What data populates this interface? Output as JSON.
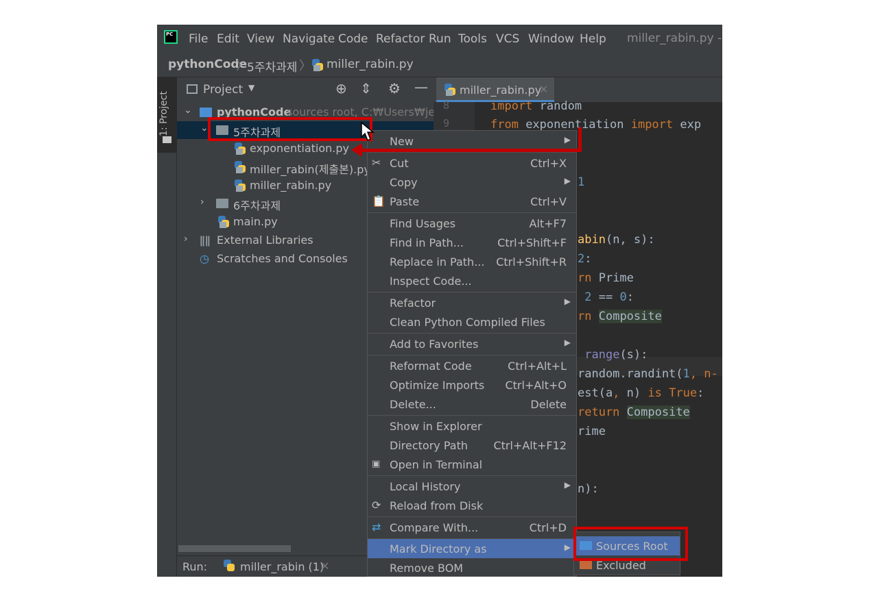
{
  "menubar": {
    "logo_text": "PC",
    "items": [
      "File",
      "Edit",
      "View",
      "Navigate",
      "Code",
      "Refactor",
      "Run",
      "Tools",
      "VCS",
      "Window",
      "Help"
    ],
    "underline": [
      "F",
      "E",
      "V",
      "N",
      "C",
      "R",
      "u",
      "T",
      "",
      "W",
      "H"
    ],
    "window_title": "miller_rabin.py - mi"
  },
  "breadcrumb": {
    "project": "pythonCode",
    "folder": "5주차과제",
    "file": "miller_rabin.py"
  },
  "left_strip": {
    "label": "1: Project"
  },
  "project_panel": {
    "title": "Project",
    "tree": {
      "root_name": "pythonCode",
      "root_meta": "sources root, C:₩Users₩jeran",
      "folder1": "5주차과제",
      "file1": "exponentiation.py",
      "file2": "miller_rabin(제출본).py",
      "file3": "miller_rabin.py",
      "folder2": "6주차과제",
      "file4": "main.py",
      "ext_libs": "External Libraries",
      "scratches": "Scratches and Consoles"
    }
  },
  "run_bar": {
    "label": "Run:",
    "config": "miller_rabin (1)"
  },
  "editor": {
    "tab_label": "miller_rabin.py",
    "line_numbers": [
      "8",
      "9"
    ],
    "code": {
      "l8_kw": "import",
      "l8_rest": " random",
      "l9_kw1": "from",
      "l9_mod": " exponentiation ",
      "l9_kw2": "import",
      "l9_rest": " exp",
      "l_num1": "1",
      "l_def": "abin",
      "l_def_rest": "(n, s):",
      "l_if1_num": "2",
      "l_if1_rest": ":",
      "l_ret1_kw": "rn",
      "l_ret1_val": " Prime",
      "l_if2_pre": " ",
      "l_if2_num1": "2",
      "l_if2_mid": " == ",
      "l_if2_num2": "0",
      "l_if2_end": ":",
      "l_ret2_kw": "rn",
      "l_ret2_val": "Composite",
      "l_for_pre": " ",
      "l_for_fn": "range",
      "l_for_rest": "(s):",
      "l_rand_pre": "random.randint(",
      "l_rand_num": "1",
      "l_rand_rest": ", n-",
      "l_test_pre": "est(a",
      "l_test_mid": ", ",
      "l_test_n": "n) ",
      "l_test_kw": "is",
      "l_test_true": " True",
      "l_test_end": ":",
      "l_ret3_kw": "return",
      "l_ret3_val": "Composite",
      "l_prime": "rime",
      "l_last": "n):"
    }
  },
  "context_menu": {
    "items": [
      {
        "label": "New",
        "shortcut": "",
        "arrow": true
      },
      {
        "label": "Cut",
        "shortcut": "Ctrl+X",
        "icon": "scissors-icon"
      },
      {
        "label": "Copy",
        "shortcut": "",
        "arrow": true
      },
      {
        "label": "Paste",
        "shortcut": "Ctrl+V",
        "icon": "clipboard-icon"
      },
      {
        "label": "Find Usages",
        "shortcut": "Alt+F7"
      },
      {
        "label": "Find in Path...",
        "shortcut": "Ctrl+Shift+F"
      },
      {
        "label": "Replace in Path...",
        "shortcut": "Ctrl+Shift+R"
      },
      {
        "label": "Inspect Code...",
        "shortcut": ""
      },
      {
        "label": "Refactor",
        "shortcut": "",
        "arrow": true
      },
      {
        "label": "Clean Python Compiled Files",
        "shortcut": ""
      },
      {
        "label": "Add to Favorites",
        "shortcut": "",
        "arrow": true
      },
      {
        "label": "Reformat Code",
        "shortcut": "Ctrl+Alt+L"
      },
      {
        "label": "Optimize Imports",
        "shortcut": "Ctrl+Alt+O"
      },
      {
        "label": "Delete...",
        "shortcut": "Delete"
      },
      {
        "label": "Show in Explorer",
        "shortcut": ""
      },
      {
        "label": "Directory Path",
        "shortcut": "Ctrl+Alt+F12"
      },
      {
        "label": "Open in Terminal",
        "shortcut": "",
        "icon": "terminal-icon"
      },
      {
        "label": "Local History",
        "shortcut": "",
        "arrow": true
      },
      {
        "label": "Reload from Disk",
        "shortcut": "",
        "icon": "reload-icon"
      },
      {
        "label": "Compare With...",
        "shortcut": "Ctrl+D",
        "icon": "compare-icon"
      },
      {
        "label": "Mark Directory as",
        "shortcut": "",
        "arrow": true,
        "active": true
      },
      {
        "label": "Remove BOM",
        "shortcut": ""
      }
    ]
  },
  "submenu": {
    "items": [
      {
        "label": "Sources Root",
        "active": true
      },
      {
        "label": "Excluded"
      }
    ]
  },
  "colors": {
    "annotation_red": "#d40000",
    "selection_blue": "#4b6eaf",
    "tree_selected": "#0d293e"
  }
}
